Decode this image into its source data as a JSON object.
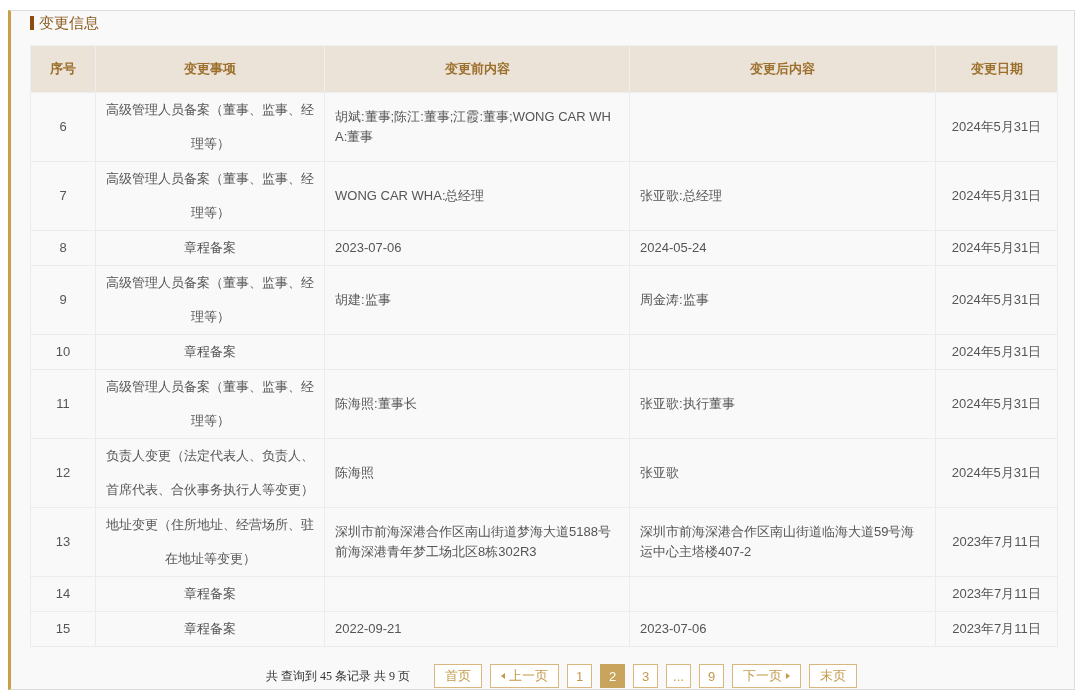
{
  "section": {
    "title": "变更信息"
  },
  "table": {
    "columns": [
      "序号",
      "变更事项",
      "变更前内容",
      "变更后内容",
      "变更日期"
    ],
    "rows": [
      {
        "index": "6",
        "item": "高级管理人员备案（董事、监事、经理等）",
        "before": "胡斌:董事;陈江:董事;江霞:董事;WONG CAR WHA:董事",
        "after": "",
        "date": "2024年5月31日"
      },
      {
        "index": "7",
        "item": "高级管理人员备案（董事、监事、经理等）",
        "before": "WONG CAR WHA:总经理",
        "after": "张亚歌:总经理",
        "date": "2024年5月31日"
      },
      {
        "index": "8",
        "item": "章程备案",
        "before": "2023-07-06",
        "after": "2024-05-24",
        "date": "2024年5月31日"
      },
      {
        "index": "9",
        "item": "高级管理人员备案（董事、监事、经理等）",
        "before": "胡建:监事",
        "after": "周金涛:监事",
        "date": "2024年5月31日"
      },
      {
        "index": "10",
        "item": "章程备案",
        "before": "",
        "after": "",
        "date": "2024年5月31日"
      },
      {
        "index": "11",
        "item": "高级管理人员备案（董事、监事、经理等）",
        "before": "陈海照:董事长",
        "after": "张亚歌:执行董事",
        "date": "2024年5月31日"
      },
      {
        "index": "12",
        "item": "负责人变更（法定代表人、负责人、首席代表、合伙事务执行人等变更）",
        "before": "陈海照",
        "after": "张亚歌",
        "date": "2024年5月31日"
      },
      {
        "index": "13",
        "item": "地址变更（住所地址、经营场所、驻在地址等变更）",
        "before": "深圳市前海深港合作区南山街道梦海大道5188号前海深港青年梦工场北区8栋302R3",
        "after": "深圳市前海深港合作区南山街道临海大道59号海运中心主塔楼407-2",
        "date": "2023年7月11日"
      },
      {
        "index": "14",
        "item": "章程备案",
        "before": "",
        "after": "",
        "date": "2023年7月11日"
      },
      {
        "index": "15",
        "item": "章程备案",
        "before": "2022-09-21",
        "after": "2023-07-06",
        "date": "2023年7月11日"
      }
    ]
  },
  "pagination": {
    "summary": "共 查询到 45 条记录 共 9 页",
    "buttons": [
      {
        "kind": "first",
        "label": "首页"
      },
      {
        "kind": "prev",
        "label": "上一页"
      },
      {
        "kind": "page",
        "label": "1",
        "selected": false
      },
      {
        "kind": "page",
        "label": "2",
        "selected": true
      },
      {
        "kind": "page",
        "label": "3",
        "selected": false
      },
      {
        "kind": "ellipsis",
        "label": "..."
      },
      {
        "kind": "page",
        "label": "9",
        "selected": false
      },
      {
        "kind": "next",
        "label": "下一页"
      },
      {
        "kind": "last",
        "label": "末页"
      }
    ]
  }
}
